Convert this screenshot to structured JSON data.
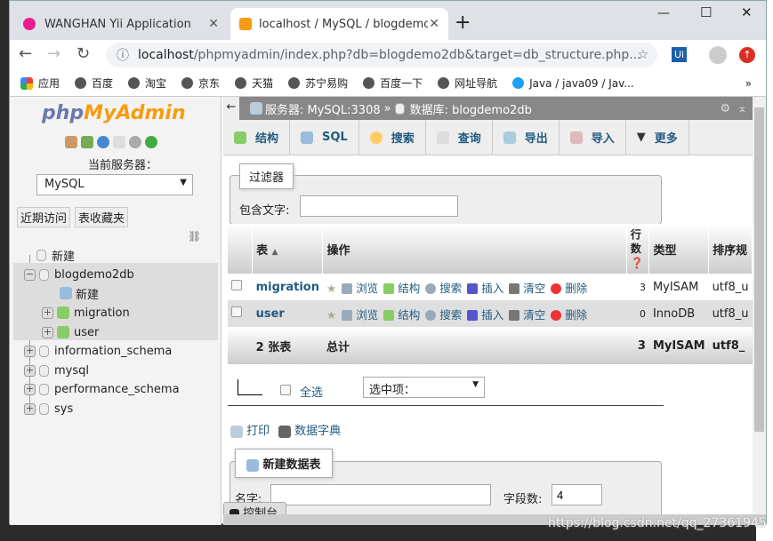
{
  "browser": {
    "tabs": [
      {
        "title": "WANGHAN Yii Application",
        "active": false
      },
      {
        "title": "localhost / MySQL / blogdemo",
        "active": true
      }
    ],
    "url_host": "localhost",
    "url_path": "/phpmyadmin/index.php?db=blogdemo2db&target=db_structure.php...",
    "extension": "Ui",
    "bookmarks": [
      "应用",
      "百度",
      "淘宝",
      "京东",
      "天猫",
      "苏宁易购",
      "百度一下",
      "网址导航",
      "Java / java09 / Jav..."
    ],
    "more": "»"
  },
  "sidebar": {
    "logo_php": "php",
    "logo_myadmin": "MyAdmin",
    "server_label": "当前服务器：",
    "server_select": "MySQL",
    "buttons": [
      "近期访问",
      "表收藏夹"
    ],
    "tree": {
      "new": "新建",
      "db": "blogdemo2db",
      "db_new": "新建",
      "tables": [
        "migration",
        "user"
      ],
      "others": [
        "information_schema",
        "mysql",
        "performance_schema",
        "sys"
      ]
    }
  },
  "main": {
    "breadcrumb": {
      "server": "服务器: MySQL:3308",
      "sep": "»",
      "database": "数据库: blogdemo2db"
    },
    "menu": [
      "结构",
      "SQL",
      "搜索",
      "查询",
      "导出",
      "导入",
      "更多"
    ],
    "filter": {
      "legend": "过滤器",
      "label": "包含文字:",
      "value": ""
    },
    "table": {
      "headers": [
        "表",
        "操作",
        "行数",
        "类型",
        "排序规"
      ],
      "actions": [
        "浏览",
        "结构",
        "搜索",
        "插入",
        "清空",
        "删除"
      ],
      "rows": [
        {
          "name": "migration",
          "rows": "3",
          "type": "MyISAM",
          "collation": "utf8_u"
        },
        {
          "name": "user",
          "rows": "0",
          "type": "InnoDB",
          "collation": "utf8_u"
        }
      ],
      "footer": {
        "count": "2 张表",
        "label": "总计",
        "rows": "3",
        "type": "MyISAM",
        "collation": "utf8_"
      }
    },
    "select_all": "全选",
    "with_selected": "选中项：",
    "print": "打印",
    "dictionary": "数据字典",
    "create": {
      "legend": "新建数据表",
      "name_label": "名字:",
      "name_value": "",
      "fields_label": "字段数:",
      "fields_value": "4"
    },
    "console": "控制台"
  },
  "watermark": "https://blog.csdn.net/qq_27361945"
}
